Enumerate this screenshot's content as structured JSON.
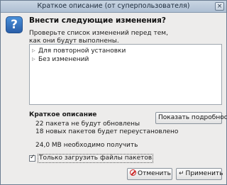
{
  "window": {
    "title": "Краткое описание (от суперпользователя)",
    "close_glyph": "×"
  },
  "dialog": {
    "icon_glyph": "?",
    "icon_name": "question-icon",
    "heading": "Внести следующие изменения?",
    "subtext": "Проверьте список изменений перед тем, как они будут выполнены."
  },
  "changes": {
    "items": [
      {
        "expander": "▷",
        "label": "Для повторной установки"
      },
      {
        "expander": "▷",
        "label": "Без изменений"
      }
    ]
  },
  "summary": {
    "title": "Краткое описание",
    "details_button": "Показать подробности",
    "lines": [
      "22 пакета не будут обновлены",
      "18 новых пакетов будет переустановлено",
      "24,0 MB необходимо получить"
    ]
  },
  "options": {
    "download_only_label": "Только загрузить файлы пакетов",
    "download_only_checked": true,
    "check_glyph": "✓"
  },
  "buttons": {
    "cancel": "Отменить",
    "apply": "Применить",
    "apply_glyph": "↵"
  },
  "colors": {
    "titlebar": "#aebfd3",
    "window_bg": "#edeceb",
    "icon_blue": "#2a5ea8",
    "cancel_red": "#cc2222"
  }
}
